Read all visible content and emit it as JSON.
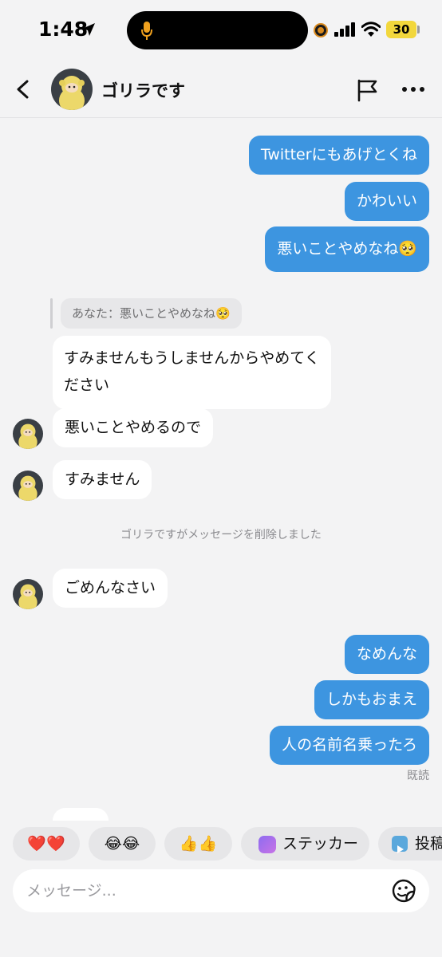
{
  "status_bar": {
    "time": "1:48",
    "battery": "30"
  },
  "header": {
    "contact_name": "ゴリラです"
  },
  "messages": {
    "me_1": "Twitterにもあげとくね",
    "me_2": "かわいい",
    "me_3": "悪いことやめなね🥺",
    "reply_quote": "あなた：悪いことやめなね🥺",
    "them_1_line1": "すみませんもうしませんからやめてく",
    "them_1_line2": "ださい",
    "them_2": "悪いことやめるので",
    "them_3": "すみません",
    "system_notice": "ゴリラですがメッセージを削除しました",
    "them_4": "ごめんなさい",
    "me_4": "なめんな",
    "me_5": "しかもおまえ",
    "me_6": "人の名前名乗ったろ",
    "read_receipt": "既読"
  },
  "quick_reactions": {
    "hearts": "❤️❤️",
    "laughs": "😂😂",
    "thumbs": "👍👍",
    "sticker": "ステッカー",
    "post": "投稿"
  },
  "composer": {
    "placeholder": "メッセージ..."
  },
  "colors": {
    "my_bubble": "#3d95e0",
    "their_bubble": "#ffffff",
    "background": "#f3f3f4"
  }
}
